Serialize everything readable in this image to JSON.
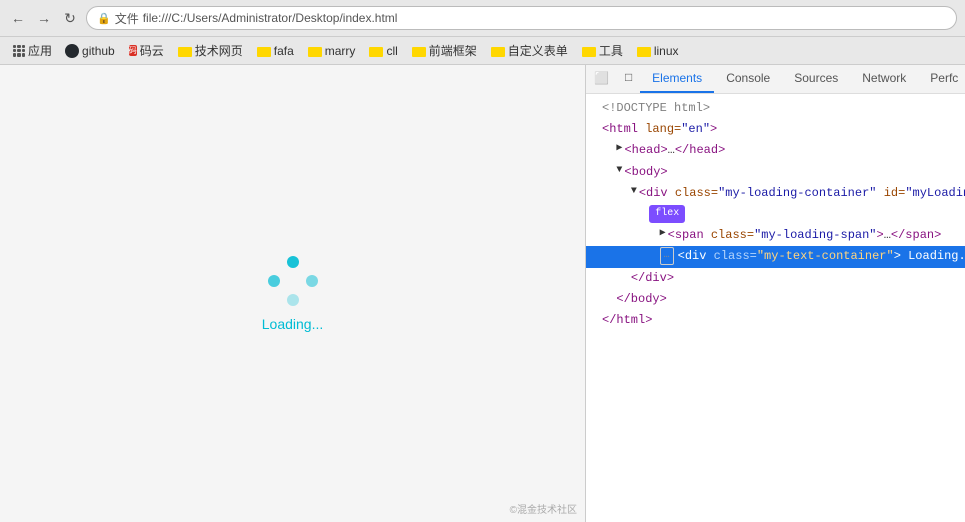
{
  "browser": {
    "back_icon": "←",
    "forward_icon": "→",
    "refresh_icon": "↻",
    "address": {
      "lock_icon": "🔒",
      "file_label": "文件",
      "url": "file:///C:/Users/Administrator/Desktop/index.html"
    },
    "bookmarks": [
      {
        "label": "应用",
        "type": "apps"
      },
      {
        "label": "github",
        "type": "github"
      },
      {
        "label": "码云",
        "type": "favicon",
        "color": "#d93025"
      },
      {
        "label": "技术网页",
        "type": "folder"
      },
      {
        "label": "fafa",
        "type": "folder"
      },
      {
        "label": "marry",
        "type": "folder"
      },
      {
        "label": "cll",
        "type": "folder"
      },
      {
        "label": "前端框架",
        "type": "folder"
      },
      {
        "label": "自定义表单",
        "type": "folder"
      },
      {
        "label": "工具",
        "type": "folder"
      },
      {
        "label": "linux",
        "type": "folder"
      }
    ]
  },
  "page": {
    "loading_text": "Loading...",
    "watermark": "©混金技术社区"
  },
  "devtools": {
    "tabs": [
      {
        "label": "⬛",
        "type": "icon",
        "active": false
      },
      {
        "label": "□",
        "type": "icon",
        "active": false
      },
      {
        "label": "Elements",
        "active": true
      },
      {
        "label": "Console",
        "active": false
      },
      {
        "label": "Sources",
        "active": false
      },
      {
        "label": "Network",
        "active": false
      },
      {
        "label": "Perfc",
        "active": false
      }
    ],
    "code_lines": [
      {
        "text": "<!DOCTYPE html>",
        "indent": 0,
        "highlighted": false
      },
      {
        "text": "<html lang=\"en\">",
        "indent": 0,
        "highlighted": false
      },
      {
        "text": "▶ <head>…</head>",
        "indent": 1,
        "highlighted": false
      },
      {
        "text": "▼ <body>",
        "indent": 1,
        "highlighted": false
      },
      {
        "text": "▼ <div class=\"my-loading-container\" id=\"myLoadingConta…",
        "indent": 2,
        "highlighted": false
      },
      {
        "text": "flex",
        "indent": 3,
        "badge": true,
        "highlighted": false
      },
      {
        "text": "▶ <span class=\"my-loading-span\">…</span>",
        "indent": 4,
        "highlighted": false
      },
      {
        "text": "… <div class=\"my-text-container\"> Loading... </div>",
        "indent": 4,
        "highlighted": true,
        "ellipsis": true
      },
      {
        "text": "</div>",
        "indent": 3,
        "highlighted": false
      },
      {
        "text": "</body>",
        "indent": 1,
        "highlighted": false
      },
      {
        "text": "</html>",
        "indent": 0,
        "highlighted": false
      }
    ]
  }
}
